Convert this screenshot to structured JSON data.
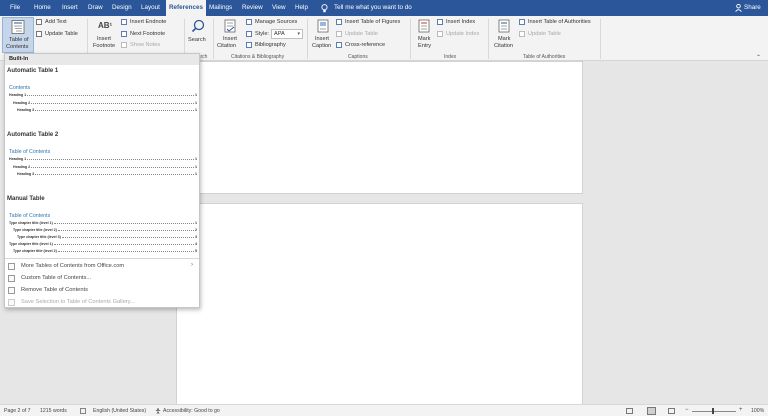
{
  "tabs": [
    "File",
    "Home",
    "Insert",
    "Draw",
    "Design",
    "Layout",
    "References",
    "Mailings",
    "Review",
    "View",
    "Help"
  ],
  "tell_me": "Tell me what you want to do",
  "share": "Share",
  "ribbon": {
    "toc_button": [
      "Table of",
      "Contents"
    ],
    "add_text": "Add Text",
    "update_table": "Update Table",
    "insert_footnote": [
      "Insert",
      "Footnote"
    ],
    "insert_endnote": "Insert Endnote",
    "next_footnote": "Next Footnote",
    "show_notes": "Show Notes",
    "search": "Search",
    "search_group": "Research",
    "insert_citation": [
      "Insert",
      "Citation"
    ],
    "manage_sources": "Manage Sources",
    "style_label": "Style:",
    "style_value": "APA",
    "bibliography": "Bibliography",
    "citations_group": "Citations & Bibliography",
    "insert_caption": [
      "Insert",
      "Caption"
    ],
    "insert_table_of_figures": "Insert Table of Figures",
    "update_table_captions": "Update Table",
    "cross_reference": "Cross-reference",
    "captions_group": "Captions",
    "mark_entry": [
      "Mark",
      "Entry"
    ],
    "insert_index": "Insert Index",
    "update_index": "Update Index",
    "index_group": "Index",
    "mark_citation": [
      "Mark",
      "Citation"
    ],
    "insert_toa": "Insert Table of Authorities",
    "update_table_toa": "Update Table",
    "toa_group": "Table of Authorities"
  },
  "dropdown": {
    "header": "Built-In",
    "auto1": {
      "name": "Automatic Table 1",
      "title": "Contents",
      "lines": [
        [
          "Heading 1",
          "1"
        ],
        [
          "Heading 2",
          "1"
        ],
        [
          "Heading 3",
          "1"
        ]
      ]
    },
    "auto2": {
      "name": "Automatic Table 2",
      "title": "Table of Contents",
      "lines": [
        [
          "Heading 1",
          "1"
        ],
        [
          "Heading 2",
          "1"
        ],
        [
          "Heading 3",
          "1"
        ]
      ]
    },
    "manual": {
      "name": "Manual Table",
      "title": "Table of Contents",
      "lines": [
        [
          "Type chapter title (level 1)",
          "1"
        ],
        [
          "Type chapter title (level 2)",
          "2"
        ],
        [
          "Type chapter title (level 3)",
          "3"
        ],
        [
          "Type chapter title (level 1)",
          "4"
        ],
        [
          "Type chapter title (level 2)",
          "5"
        ]
      ]
    },
    "menu": [
      "More Tables of Contents from Office.com",
      "Custom Table of Contents...",
      "Remove Table of Contents",
      "Save Selection to Table of Contents Gallery..."
    ]
  },
  "status": {
    "page": "Page 2 of 7",
    "words": "1215 words",
    "language": "English (United States)",
    "accessibility": "Accessibility: Good to go",
    "zoom": "100%"
  },
  "colors": {
    "brand": "#2b579a",
    "toc_title": "#2e74b5"
  }
}
